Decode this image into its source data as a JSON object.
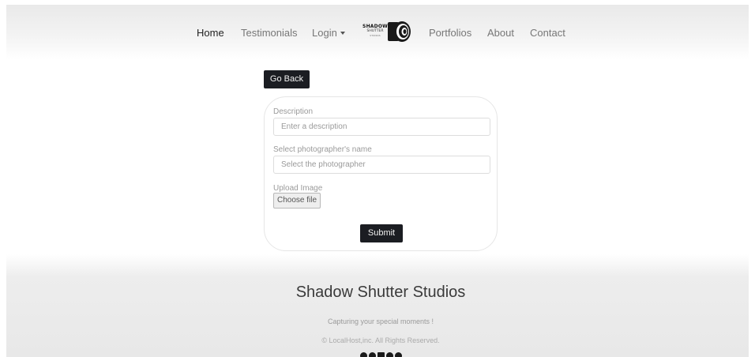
{
  "nav": {
    "home": "Home",
    "testimonials": "Testimonials",
    "login": "Login",
    "portfolios": "Portfolios",
    "about": "About",
    "contact": "Contact"
  },
  "logo": {
    "line1": "SHADOW",
    "line2": "SHUTTER",
    "line3": "STUDIOS"
  },
  "back_button": "Go Back",
  "form": {
    "description_label": "Description",
    "description_placeholder": "Enter a description",
    "photographer_label": "Select photographer's name",
    "photographer_placeholder": "Select the photographer",
    "upload_label": "Upload Image",
    "file_button": "Choose file",
    "submit": "Submit"
  },
  "footer": {
    "title": "Shadow Shutter Studios",
    "tagline": "Capturing your special moments !",
    "copyright": "© LocalHost,inc. All Rights Reserved.",
    "social_icons": [
      "facebook-icon",
      "instagram-icon",
      "square-icon",
      "twitter-icon",
      "youtube-icon"
    ]
  },
  "colors": {
    "accent": "#1b1d22",
    "text": "#222222",
    "muted": "#9a9a9a"
  }
}
